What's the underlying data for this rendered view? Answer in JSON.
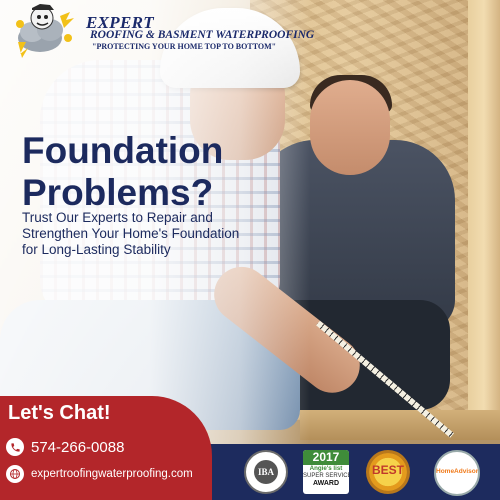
{
  "logo": {
    "title": "EXPERT",
    "subtitle": "ROOFING & BASMENT WATERPROOFING",
    "slogan": "\"PROTECTING YOUR HOME TOP TO BOTTOM\""
  },
  "headline": {
    "line1": "Foundation",
    "line2": "Problems?"
  },
  "subheadline": {
    "line1": "Trust Our Experts to Repair and",
    "line2": "Strengthen Your Home's Foundation",
    "line3": "for Long-Lasting Stability"
  },
  "contact": {
    "title": "Let's Chat!",
    "phone": "574-266-0088",
    "website": "expertroofingwaterproofing.com",
    "phone_icon": "phone-icon",
    "web_icon": "globe-icon"
  },
  "badges": {
    "angies_year": "2017",
    "angies_name": "Angie's list",
    "angies_line2": "SUPER SERVICE",
    "angies_line3": "AWARD",
    "bba_letters": "IBA",
    "best_text": "BEST",
    "homeadvisor_text": "HomeAdvisor"
  },
  "colors": {
    "navy": "#1c2a5e",
    "red": "#b3262a",
    "bar": "#1d2b5e"
  }
}
